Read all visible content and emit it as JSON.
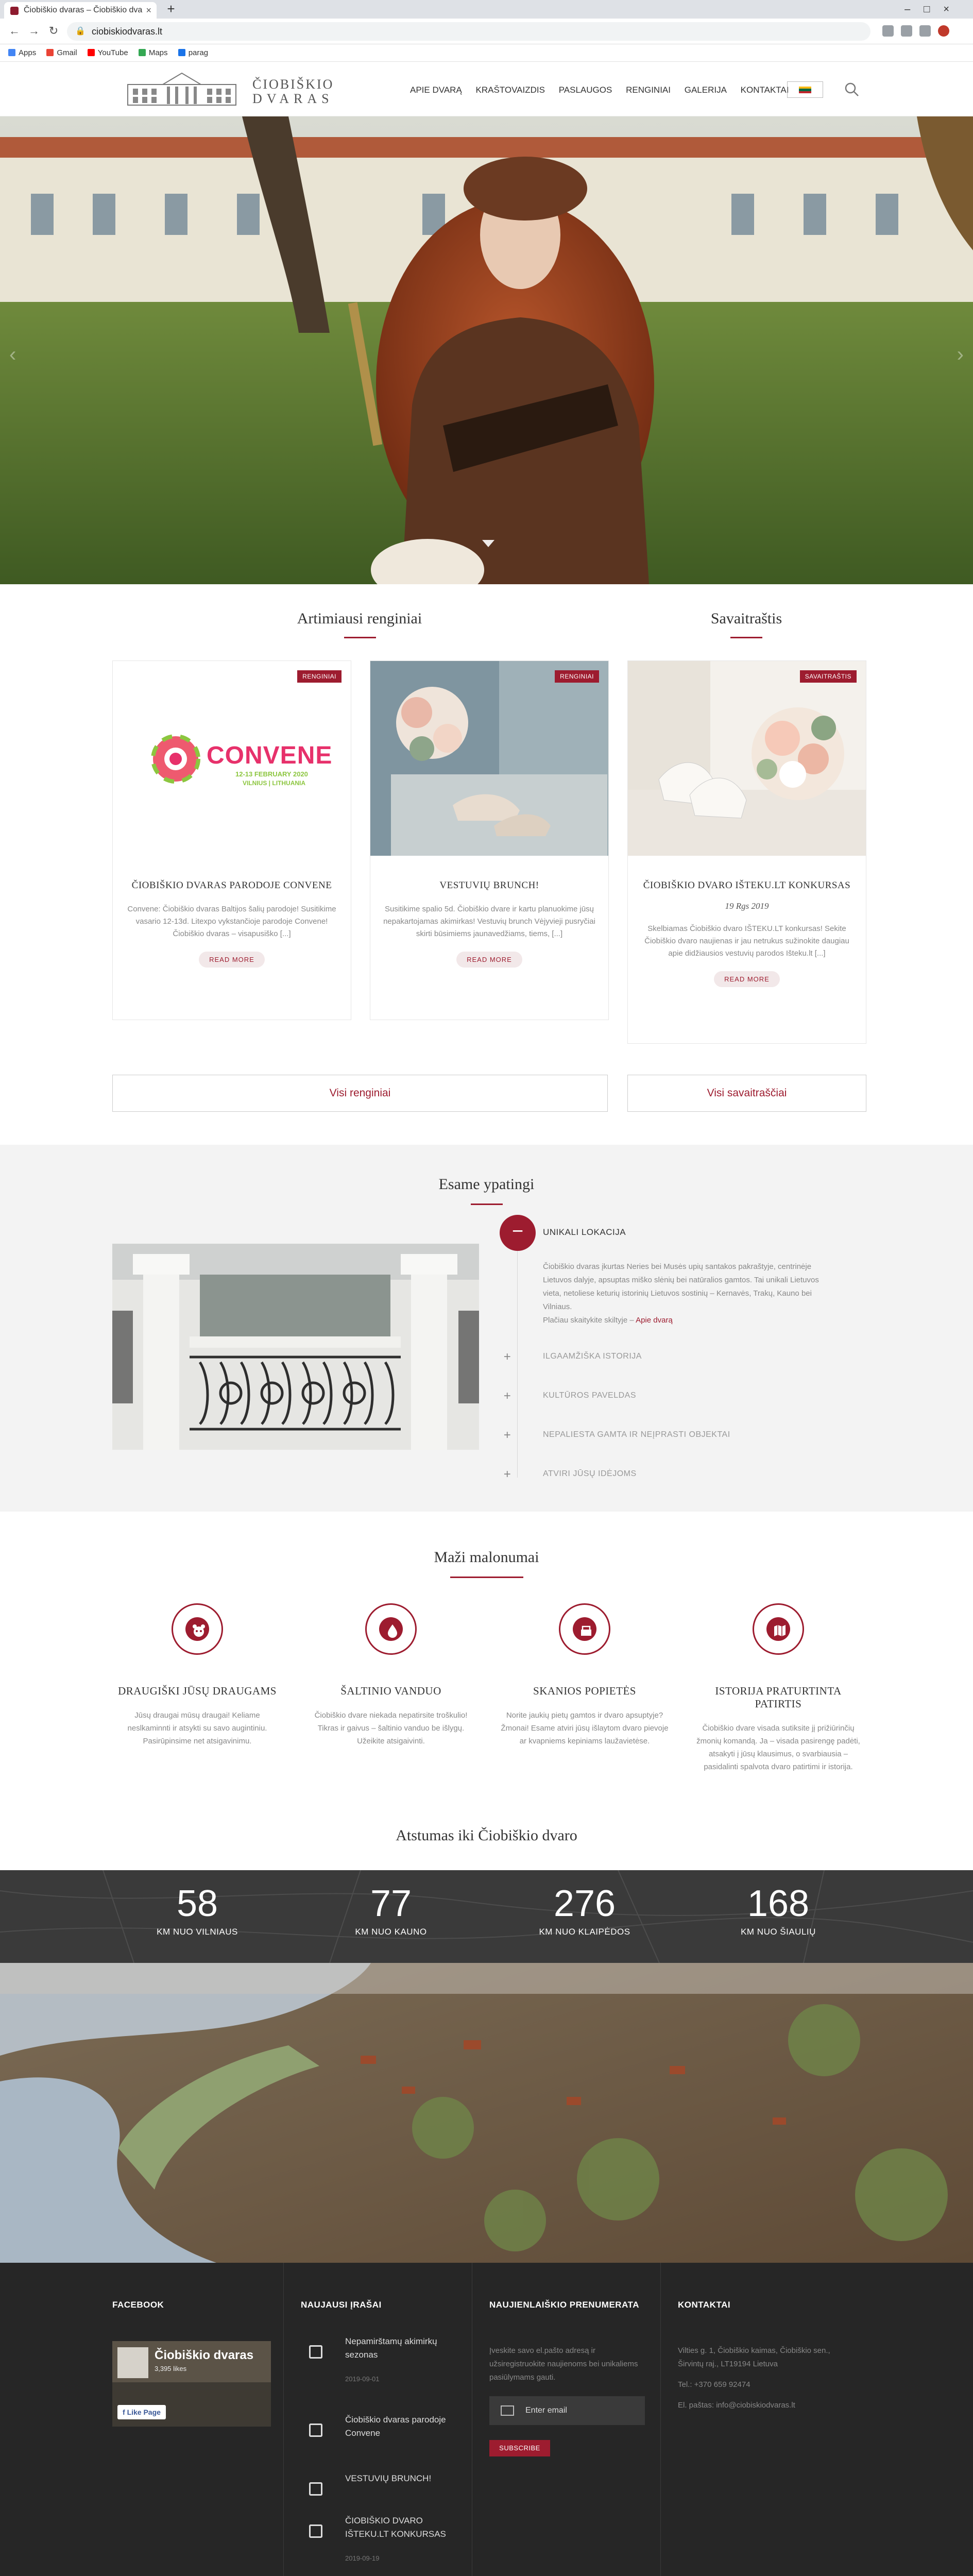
{
  "browser": {
    "tab_title": "Čiobiškio dvaras – Čiobiškio dva",
    "url": "ciobiskiodvaras.lt",
    "bookmarks": [
      "Apps",
      "Gmail",
      "YouTube",
      "Maps",
      "parag"
    ]
  },
  "header": {
    "logo_line1": "ČIOBIŠKIO",
    "logo_line2": "DVARAS",
    "nav": [
      "APIE DVARĄ",
      "KRAŠTOVAIZDIS",
      "PASLAUGOS",
      "RENGINIAI",
      "GALERIJA",
      "KONTAKTAI"
    ]
  },
  "events": {
    "title": "Artimiausi renginiai",
    "blog_title": "Savaitraštis",
    "cards": [
      {
        "badge": "RENGINIAI",
        "logo_word": "CONVENE",
        "logo_date": "12-13 FEBRUARY 2020",
        "logo_place": "VILNIUS | LITHUANIA",
        "title": "ČIOBIŠKIO DVARAS PARODOJE CONVENE",
        "text": "Convene: Čiobiškio dvaras Baltijos šalių parodoje! Susitikime vasario 12-13d. Litexpo vykstančioje parodoje Convene! Čiobiškio dvaras – visapusiško [...]",
        "more": "READ MORE"
      },
      {
        "badge": "RENGINIAI",
        "title": "VESTUVIŲ BRUNCH!",
        "text": "Susitikime spalio 5d. Čiobiškio dvare ir kartu planuokime jūsų nepakartojamas akimirkas! Vestuvių brunch Vėjyvieji pusryčiai skirti būsimiems jaunavedžiams, tiems, [...]",
        "more": "READ MORE"
      },
      {
        "badge": "SAVAITRAŠTIS",
        "title": "ČIOBIŠKIO DVARO IŠTEKU.LT KONKURSAS",
        "date": "19 Rgs 2019",
        "text": "Skelbiamas Čiobiškio dvaro IŠTEKU.LT konkursas! Sekite Čiobiškio dvaro naujienas ir jau netrukus sužinokite daugiau apie didžiausios vestuvių parodos Išteku.lt [...]",
        "more": "READ MORE"
      }
    ],
    "btn_all_events": "Visi renginiai",
    "btn_all_blog": "Visi savaitraščiai"
  },
  "special": {
    "title": "Esame ypatingi",
    "open_item": {
      "label": "UNIKALI LOKACIJA",
      "text": "Čiobiškio dvaras įkurtas Neries bei Musės upių santakos pakraštyje, centrinėje Lietuvos dalyje, apsuptas miško slėnių bei natūralios gamtos. Tai unikali Lietuvos vieta, netoliese keturių istorinių Lietuvos sostinių – Kernavės, Trakų, Kauno bei Vilniaus.",
      "more_prefix": "Plačiau skaitykite skiltyje – ",
      "more_link": "Apie dvarą"
    },
    "items": [
      "ILGAAMŽIŠKA ISTORIJA",
      "KULTŪROS PAVELDAS",
      "NEPALIESTA GAMTA IR NEĮPRASTI OBJEKTAI",
      "ATVIRI JŪSŲ IDĖJOMS"
    ]
  },
  "pleasures": {
    "title": "Maži malonumai",
    "items": [
      {
        "icon": "pet-icon",
        "title": "DRAUGIŠKI JŪSŲ DRAUGAMS",
        "text": "Jūsų draugai mūsų draugai! Keliame neslkaminnti ir atsykti su savo augintiniu. Pasirūpinsime net atsigavinimu."
      },
      {
        "icon": "water-drop-icon",
        "title": "ŠALTINIO VANDUO",
        "text": "Čiobiškio dvare niekada nepatirsite troškulio! Tikras ir gaivus – šaltinio vanduo be išlygų. Užeikite atsigaivinti."
      },
      {
        "icon": "basket-icon",
        "title": "SKANIOS POPIETĖS",
        "text": "Norite jaukių pietų gamtos ir dvaro apsuptyje? Žmonai! Esame atviri jūsų išlaytom dvaro pievoje ar kvapniems kepiniams laužavietėse."
      },
      {
        "icon": "map-icon",
        "title": "ISTORIJA PRATURTINTA PATIRTIS",
        "text": "Čiobiškio dvare visada sutiksite jį prižiūrinčių žmonių komandą. Ja – visada pasirengę padėti, atsakyti į jūsų klausimus, o svarbiausia – pasidalinti spalvota dvaro patirtimi ir istorija."
      }
    ]
  },
  "distance": {
    "title": "Atstumas iki Čiobiškio dvaro",
    "stats": [
      {
        "value": "58",
        "label": "KM NUO VILNIAUS"
      },
      {
        "value": "77",
        "label": "KM NUO KAUNO"
      },
      {
        "value": "276",
        "label": "KM NUO KLAIPĖDOS"
      },
      {
        "value": "168",
        "label": "KM NUO ŠIAULIŲ"
      }
    ]
  },
  "footer": {
    "facebook_title": "FACEBOOK",
    "fb_page_name": "Čiobiškio dvaras",
    "fb_likes": "3,395 likes",
    "fb_like_btn": "Like Page",
    "posts_title": "NAUJAUSI ĮRAŠAI",
    "posts": [
      {
        "title": "Nepamirštamų akimirkų sezonas",
        "date": "2019-09-01"
      },
      {
        "title": "Čiobiškio dvaras parodoje Convene",
        "date": ""
      },
      {
        "title": "VESTUVIŲ BRUNCH!",
        "date": ""
      },
      {
        "title": "ČIOBIŠKIO DVARO IŠTEKU.LT KONKURSAS",
        "date": "2019-09-19"
      }
    ],
    "newsletter_title": "NAUJIENLAIŠKIO PRENUMERATA",
    "newsletter_text": "Įveskite savo el.pašto adresą ir užsiregistruokite naujienoms bei unikaliems pasiūlymams gauti.",
    "email_placeholder": "Enter email",
    "subscribe": "SUBSCRIBE",
    "contacts_title": "KONTAKTAI",
    "address": "Vilties g. 1, Čiobiškio kaimas, Čiobiškio sen., Širvintų raj., LT19194 Lietuva",
    "phone": "Tel.: +370 659 92474",
    "email": "El. paštas: info@ciobiskiodvaras.lt"
  },
  "colors": {
    "accent": "#9d1c2f",
    "footer_bg": "#262626"
  }
}
